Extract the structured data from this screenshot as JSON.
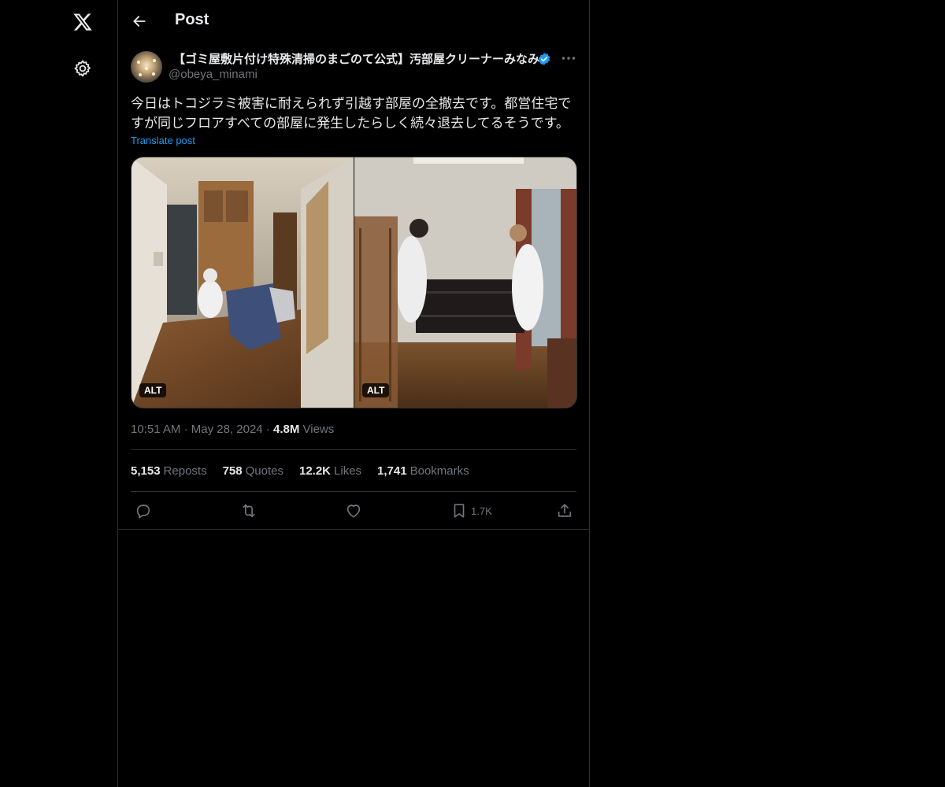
{
  "header": {
    "title": "Post",
    "back_icon": "arrow-left-icon"
  },
  "sidebar": {
    "logo_icon": "x-logo-icon",
    "settings_icon": "gear-icon"
  },
  "post": {
    "author": {
      "display_name": "【ゴミ屋敷片付け特殊清掃のまごのて公式】汚部屋クリーナーみなみ",
      "handle": "@obeya_minami",
      "verified": true
    },
    "text": "今日はトコジラミ被害に耐えられず引越す部屋の全撤去です。都営住宅ですが同じフロアすべての部屋に発生したらしく続々退去してるそうです。",
    "translate_label": "Translate post",
    "media": [
      {
        "alt_label": "ALT"
      },
      {
        "alt_label": "ALT"
      }
    ],
    "time": "10:51 AM",
    "date": "May 28, 2024",
    "views_count": "4.8M",
    "views_label": "Views",
    "separator": "·",
    "stats": [
      {
        "count": "5,153",
        "label": "Reposts"
      },
      {
        "count": "758",
        "label": "Quotes"
      },
      {
        "count": "12.2K",
        "label": "Likes"
      },
      {
        "count": "1,741",
        "label": "Bookmarks"
      }
    ],
    "actions": {
      "bookmark_count": "1.7K"
    }
  },
  "colors": {
    "background": "#000000",
    "text_primary": "#e7e9ea",
    "text_secondary": "#71767b",
    "accent": "#1d9bf0",
    "border": "#2f3336"
  }
}
